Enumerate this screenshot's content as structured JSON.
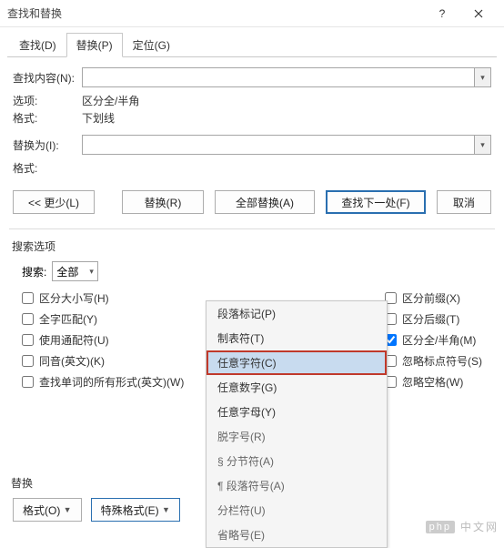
{
  "title": "查找和替换",
  "tabs": {
    "find": "查找(D)",
    "replace": "替换(P)",
    "goto": "定位(G)"
  },
  "form": {
    "find_label": "查找内容(N):",
    "opt_label": "选项:",
    "opt_value": "区分全/半角",
    "fmt_label": "格式:",
    "fmt_value": "下划线",
    "repl_label": "替换为(I):",
    "fmt2_label": "格式:"
  },
  "buttons": {
    "less": "<< 更少(L)",
    "replace": "替换(R)",
    "replace_all": "全部替换(A)",
    "find_next": "查找下一处(F)",
    "cancel": "取消"
  },
  "search_options": {
    "title": "搜索选项",
    "search_label": "搜索:",
    "search_value": "全部"
  },
  "checks_left": [
    {
      "label": "区分大小写(H)",
      "checked": false
    },
    {
      "label": "全字匹配(Y)",
      "checked": false
    },
    {
      "label": "使用通配符(U)",
      "checked": false
    },
    {
      "label": "同音(英文)(K)",
      "checked": false
    },
    {
      "label": "查找单词的所有形式(英文)(W)",
      "checked": false
    }
  ],
  "checks_right": [
    {
      "label": "区分前缀(X)",
      "checked": false
    },
    {
      "label": "区分后缀(T)",
      "checked": false
    },
    {
      "label": "区分全/半角(M)",
      "checked": true
    },
    {
      "label": "忽略标点符号(S)",
      "checked": false
    },
    {
      "label": "忽略空格(W)",
      "checked": false
    }
  ],
  "popup": [
    {
      "label": "段落标记(P)",
      "enabled": true
    },
    {
      "label": "制表符(T)",
      "enabled": true
    },
    {
      "label": "任意字符(C)",
      "enabled": true,
      "highlight": true
    },
    {
      "label": "任意数字(G)",
      "enabled": true
    },
    {
      "label": "任意字母(Y)",
      "enabled": true
    },
    {
      "label": "脱字号(R)",
      "enabled": false
    },
    {
      "label": "§ 分节符(A)",
      "enabled": false
    },
    {
      "label": "¶ 段落符号(A)",
      "enabled": false
    },
    {
      "label": "分栏符(U)",
      "enabled": false
    },
    {
      "label": "省略号(E)",
      "enabled": false
    }
  ],
  "bottom": {
    "label": "替换",
    "format": "格式(O)",
    "special": "特殊格式(E)"
  },
  "watermark": "中文网"
}
